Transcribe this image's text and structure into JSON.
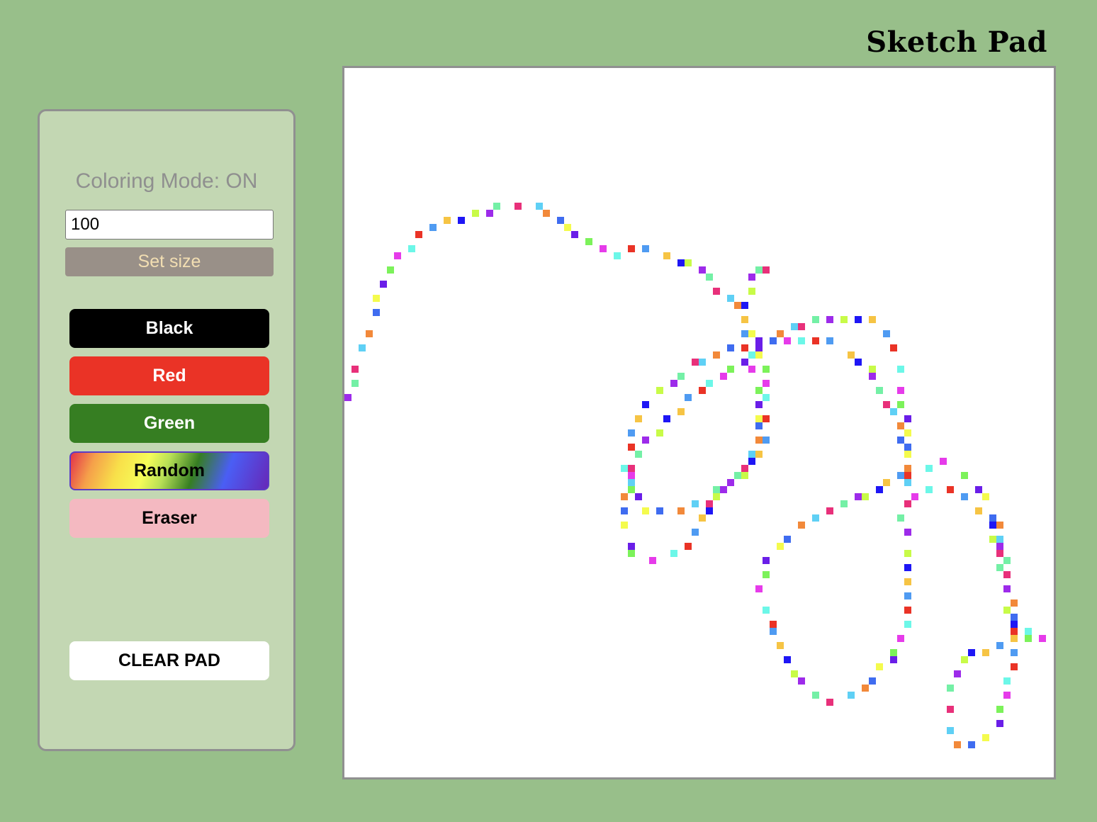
{
  "app": {
    "title": "Sketch Pad"
  },
  "controls": {
    "mode_label": "Coloring Mode: ON",
    "grid_size_value": "100",
    "set_size_label": "Set size",
    "buttons": {
      "black": "Black",
      "red": "Red",
      "green": "Green",
      "random": "Random",
      "eraser": "Eraser",
      "clear": "CLEAR PAD"
    }
  },
  "pad": {
    "grid_cells_per_side": 100,
    "background": "#ffffff",
    "palette": [
      "#ea3326",
      "#e8307a",
      "#e63bea",
      "#9d2bea",
      "#6a1ee8",
      "#1e16f5",
      "#3f6cf0",
      "#4f9bf2",
      "#5fd0f5",
      "#6cf7e8",
      "#74f0a6",
      "#7cf25a",
      "#c8fb48",
      "#f4fb4d",
      "#f6c444",
      "#f2893a"
    ]
  }
}
